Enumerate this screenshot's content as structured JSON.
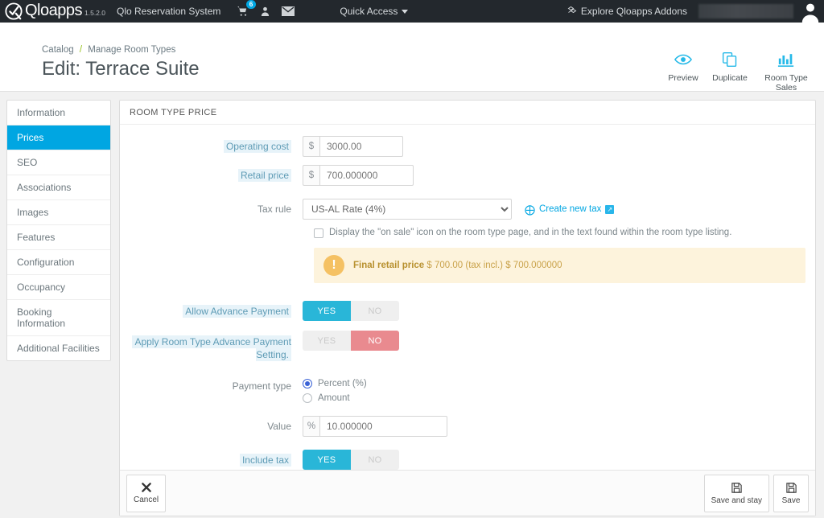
{
  "topbar": {
    "brand_name": "Qloapps",
    "version": "1.5.2.0",
    "shop_name": "Qlo Reservation System",
    "cart_icon": "cart-icon",
    "cart_badge": "6",
    "customers_icon": "person-icon",
    "messages_icon": "envelope-icon",
    "quick_access": "Quick Access",
    "addons_label": "Explore Qloapps Addons",
    "addons_icon": "addons-icon",
    "avatar": "user-avatar"
  },
  "header": {
    "breadcrumb_root": "Catalog",
    "breadcrumb_sep": "/",
    "breadcrumb_current": "Manage Room Types",
    "title": "Edit: Terrace Suite",
    "toolbar": [
      {
        "label": "Preview",
        "icon": "eye-icon"
      },
      {
        "label": "Duplicate",
        "icon": "duplicate-icon"
      },
      {
        "label": "Room Type Sales",
        "icon": "bar-chart-icon"
      }
    ]
  },
  "sidebar": {
    "items": [
      {
        "label": "Information",
        "active": false
      },
      {
        "label": "Prices",
        "active": true
      },
      {
        "label": "SEO",
        "active": false
      },
      {
        "label": "Associations",
        "active": false
      },
      {
        "label": "Images",
        "active": false
      },
      {
        "label": "Features",
        "active": false
      },
      {
        "label": "Configuration",
        "active": false
      },
      {
        "label": "Occupancy",
        "active": false
      },
      {
        "label": "Booking Information",
        "active": false
      },
      {
        "label": "Additional Facilities",
        "active": false
      }
    ]
  },
  "panel": {
    "title": "ROOM TYPE PRICE",
    "operating_cost": {
      "label": "Operating cost",
      "currency": "$",
      "value": "3000.00"
    },
    "retail_price": {
      "label": "Retail price",
      "currency": "$",
      "value": "700.000000"
    },
    "tax_rule": {
      "label": "Tax rule",
      "value": "US-AL Rate (4%)",
      "create_link": "Create new tax"
    },
    "on_sale": {
      "text": "Display the \"on sale\" icon on the room type page, and in the text found within the room type listing.",
      "checked": false
    },
    "final_price": {
      "strong": "Final retail price",
      "rest": "$ 700.00 (tax incl.) $ 700.000000"
    },
    "allow_advance_payment": {
      "label": "Allow Advance Payment",
      "yes": "YES",
      "no": "NO",
      "state": "yes"
    },
    "apply_room_type_setting": {
      "label": "Apply Room Type Advance Payment Setting.",
      "yes": "YES",
      "no": "NO",
      "state": "no"
    },
    "payment_type": {
      "label": "Payment type",
      "options": [
        "Percent (%)",
        "Amount"
      ],
      "selected": "Percent (%)"
    },
    "value_field": {
      "label": "Value",
      "unit": "%",
      "value": "10.000000"
    },
    "include_tax": {
      "label": "Include tax",
      "yes": "YES",
      "no": "NO",
      "state": "yes"
    }
  },
  "footer": {
    "cancel": "Cancel",
    "cancel_icon": "close-icon",
    "save_and_stay": "Save and stay",
    "save": "Save",
    "save_icon": "floppy-icon"
  },
  "colors": {
    "accent": "#00a6e2",
    "toggle_on": "#29b6d8",
    "toggle_no": "#e98a8f",
    "alert_bg": "#fdf3dc",
    "topbar": "#23282d"
  }
}
